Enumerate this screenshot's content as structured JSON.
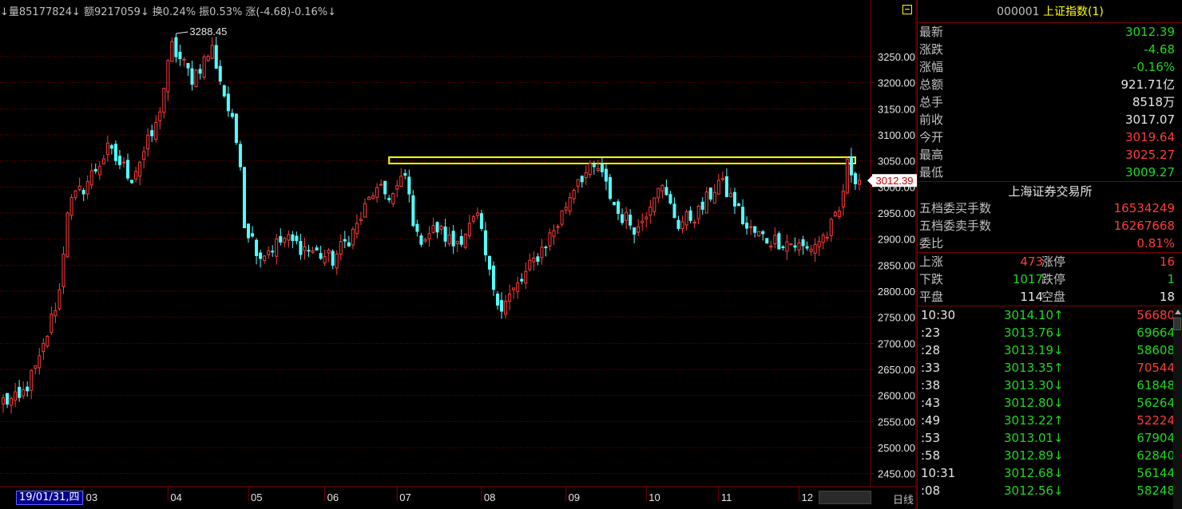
{
  "topbar": {
    "items": [
      {
        "text": "↓量85177824↓",
        "color": "#c0c0c0"
      },
      {
        "text": "额9217059↓",
        "color": "#c0c0c0"
      },
      {
        "text": "换0.24%",
        "color": "#c0c0c0"
      },
      {
        "text": "振0.53%",
        "color": "#c0c0c0"
      },
      {
        "text": "涨(-4.68)-0.16%↓",
        "color": "#c0c0c0"
      }
    ]
  },
  "chart_data": {
    "type": "candlestick",
    "title": "",
    "period_label": "日线",
    "selected_date": "19/01/31,四",
    "current_price_label": "3012.39",
    "high_annotation": "3288.45",
    "ylim": [
      2425,
      3325
    ],
    "y_ticks": [
      "2450.00",
      "2500.00",
      "2550.00",
      "2600.00",
      "2650.00",
      "2700.00",
      "2750.00",
      "2800.00",
      "2850.00",
      "2900.00",
      "2950.00",
      "3000.00",
      "3050.00",
      "3100.00",
      "3150.00",
      "3200.00",
      "3250.00"
    ],
    "x_tick_labels": [
      "03",
      "04",
      "05",
      "06",
      "07",
      "08",
      "09",
      "10",
      "11",
      "12"
    ],
    "x_tick_index": [
      20,
      41,
      61,
      80,
      98,
      119,
      140,
      160,
      178,
      198
    ],
    "resistance_band": {
      "low": 3045,
      "high": 3057,
      "from_index": 96,
      "to_index": 212
    },
    "colors": {
      "up": "#ff3c3c",
      "down": "#54ffff",
      "grid": "#800000",
      "axis": "#c0c0c0",
      "band": "#ffff00"
    },
    "anchors": [
      [
        0,
        2590
      ],
      [
        4,
        2590
      ],
      [
        9,
        2665
      ],
      [
        14,
        2800
      ],
      [
        16,
        2960
      ],
      [
        20,
        3000
      ],
      [
        26,
        3070
      ],
      [
        32,
        3020
      ],
      [
        38,
        3115
      ],
      [
        42,
        3268
      ],
      [
        47,
        3210
      ],
      [
        52,
        3265
      ],
      [
        57,
        3120
      ],
      [
        59,
        3055
      ],
      [
        60,
        2930
      ],
      [
        64,
        2870
      ],
      [
        70,
        2900
      ],
      [
        76,
        2880
      ],
      [
        82,
        2860
      ],
      [
        88,
        2925
      ],
      [
        92,
        2990
      ],
      [
        97,
        2985
      ],
      [
        100,
        3020
      ],
      [
        103,
        2900
      ],
      [
        108,
        2920
      ],
      [
        112,
        2890
      ],
      [
        118,
        2940
      ],
      [
        121,
        2830
      ],
      [
        124,
        2770
      ],
      [
        129,
        2820
      ],
      [
        133,
        2870
      ],
      [
        138,
        2930
      ],
      [
        143,
        3020
      ],
      [
        148,
        3035
      ],
      [
        153,
        2950
      ],
      [
        158,
        2920
      ],
      [
        163,
        3010
      ],
      [
        168,
        2930
      ],
      [
        173,
        2950
      ],
      [
        178,
        3010
      ],
      [
        182,
        2970
      ],
      [
        185,
        2920
      ],
      [
        190,
        2900
      ],
      [
        195,
        2895
      ],
      [
        200,
        2880
      ],
      [
        205,
        2910
      ],
      [
        208,
        2950
      ],
      [
        210,
        3040
      ],
      [
        213,
        3012.39
      ]
    ]
  },
  "panel": {
    "code": "000001",
    "name": "上证指数(1)",
    "quotes": [
      {
        "label": "最新",
        "value": "3012.39",
        "color": "green"
      },
      {
        "label": "涨跌",
        "value": "-4.68",
        "color": "green"
      },
      {
        "label": "涨幅",
        "value": "-0.16%",
        "color": "green"
      },
      {
        "label": "总额",
        "value": "921.71亿",
        "color": "white"
      },
      {
        "label": "总手",
        "value": "8518万",
        "color": "white"
      },
      {
        "label": "前收",
        "value": "3017.07",
        "color": "white"
      },
      {
        "label": "今开",
        "value": "3019.64",
        "color": "red"
      },
      {
        "label": "最高",
        "value": "3025.27",
        "color": "red"
      },
      {
        "label": "最低",
        "value": "3009.27",
        "color": "green"
      }
    ],
    "exchange": "上海证券交易所",
    "orders": [
      {
        "label": "五档委买手数",
        "value": "16534249",
        "color": "red"
      },
      {
        "label": "五档委卖手数",
        "value": "16267668",
        "color": "red"
      },
      {
        "label": "委比",
        "value": "0.81%",
        "color": "red"
      }
    ],
    "advance": [
      {
        "k1": "上涨",
        "v1": "473",
        "c1": "red",
        "k2": "涨停",
        "v2": "16",
        "c2": "red"
      },
      {
        "k1": "下跌",
        "v1": "1017",
        "c1": "green",
        "k2": "跌停",
        "v2": "1",
        "c2": "green"
      },
      {
        "k1": "平盘",
        "v1": "114",
        "c1": "white",
        "k2": "空盘",
        "v2": "18",
        "c2": "white"
      }
    ],
    "ticks": [
      {
        "time": "10:30",
        "price": "3014.10↑",
        "pcolor": "green",
        "vol": "56680",
        "vcolor": "red"
      },
      {
        "time": ":23",
        "price": "3013.76↓",
        "pcolor": "green",
        "vol": "69664",
        "vcolor": "green"
      },
      {
        "time": ":28",
        "price": "3013.19↓",
        "pcolor": "green",
        "vol": "58608",
        "vcolor": "green"
      },
      {
        "time": ":33",
        "price": "3013.35↑",
        "pcolor": "green",
        "vol": "70544",
        "vcolor": "red"
      },
      {
        "time": ":38",
        "price": "3013.30↓",
        "pcolor": "green",
        "vol": "61848",
        "vcolor": "green"
      },
      {
        "time": ":43",
        "price": "3012.80↓",
        "pcolor": "green",
        "vol": "56264",
        "vcolor": "green"
      },
      {
        "time": ":49",
        "price": "3013.22↑",
        "pcolor": "green",
        "vol": "52224",
        "vcolor": "red"
      },
      {
        "time": ":53",
        "price": "3013.01↓",
        "pcolor": "green",
        "vol": "67904",
        "vcolor": "green"
      },
      {
        "time": ":58",
        "price": "3012.89↓",
        "pcolor": "green",
        "vol": "62840",
        "vcolor": "green"
      },
      {
        "time": "10:31",
        "price": "3012.68↓",
        "pcolor": "green",
        "vol": "56144",
        "vcolor": "green"
      },
      {
        "time": ":08",
        "price": "3012.56↓",
        "pcolor": "green",
        "vol": "58248",
        "vcolor": "green"
      }
    ]
  }
}
